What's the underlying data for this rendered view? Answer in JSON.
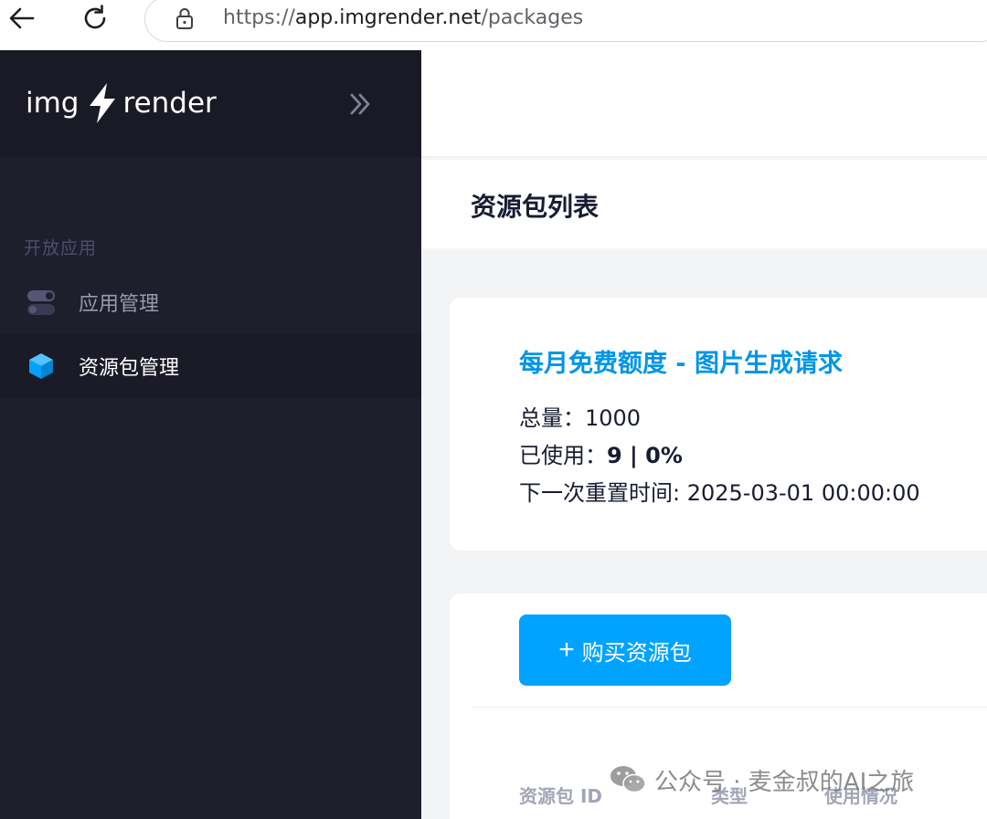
{
  "browser": {
    "url_prefix": "https://",
    "url_host": "app.imgrender.net",
    "url_path": "/packages"
  },
  "sidebar": {
    "logo_left": "img",
    "logo_right": "render",
    "section_label": "开放应用",
    "items": [
      {
        "label": "应用管理",
        "icon": "toggle-icon",
        "active": false
      },
      {
        "label": "资源包管理",
        "icon": "cube-icon",
        "active": true
      }
    ]
  },
  "page": {
    "title": "资源包列表"
  },
  "quota": {
    "title": "每月免费额度 - 图片生成请求",
    "total_label": "总量：",
    "total_value": "1000",
    "used_label": "已使用：",
    "used_value": "9 | 0%",
    "reset_label": "下一次重置时间: ",
    "reset_value": "2025-03-01 00:00:00"
  },
  "packages": {
    "buy_label": "购买资源包",
    "columns": [
      "资源包 ID",
      "类型",
      "使用情况"
    ]
  },
  "watermark": {
    "text": "公众号 · 麦金叔的AI之旅"
  },
  "colors": {
    "sidebar_bg": "#1e1e2d",
    "accent": "#00a3ff",
    "quota_title": "#0095e8"
  }
}
